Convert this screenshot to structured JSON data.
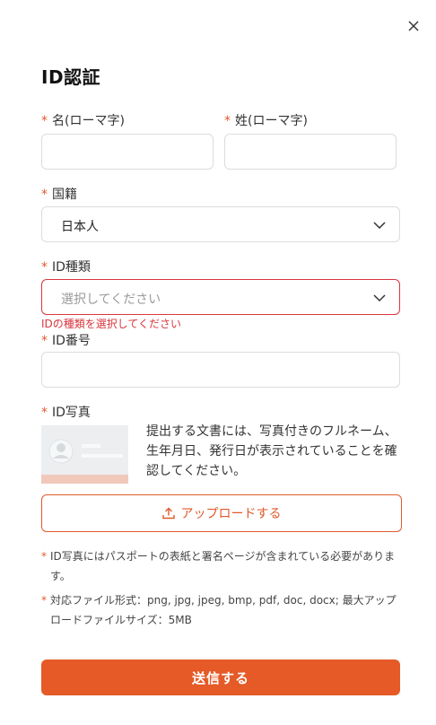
{
  "title": "ID認証",
  "required_mark": "*",
  "fields": {
    "first_name": {
      "label": "名(ローマ字)",
      "value": ""
    },
    "last_name": {
      "label": "姓(ローマ字)",
      "value": ""
    },
    "nationality": {
      "label": "国籍",
      "value": "日本人"
    },
    "id_type": {
      "label": "ID種類",
      "placeholder": "選択してください",
      "error": "IDの種類を選択してください"
    },
    "id_number": {
      "label": "ID番号",
      "value": ""
    },
    "id_photo": {
      "label": "ID写真",
      "description": "提出する文書には、写真付きのフルネーム、生年月日、発行日が表示されていることを確認してください。"
    }
  },
  "upload_label": "アップロードする",
  "notes": [
    "ID写真にはパスポートの表紙と署名ページが含まれている必要があります。",
    "対応ファイル形式：png, jpg, jpeg, bmp, pdf, doc, docx; 最大アップロードファイルサイズ：5MB"
  ],
  "submit_label": "送信する",
  "colors": {
    "accent": "#e55a26",
    "error": "#d9363e",
    "border": "#dcdcdc"
  },
  "icons": {
    "close": "close-icon",
    "chevron": "chevron-down-icon",
    "upload": "upload-icon"
  }
}
